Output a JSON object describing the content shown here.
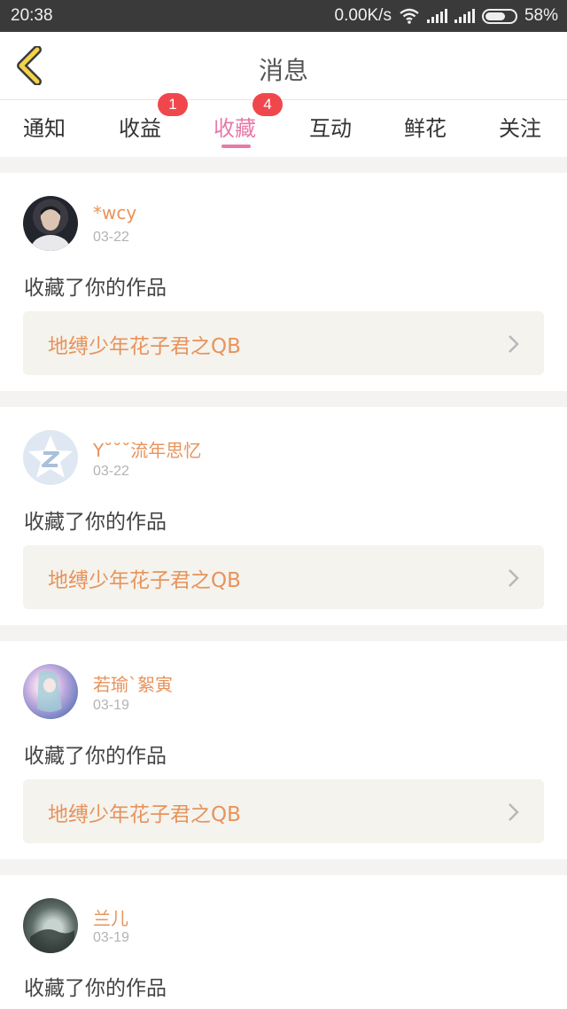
{
  "status_bar": {
    "time": "20:38",
    "network_speed": "0.00K/s",
    "battery": "58%",
    "battery_level": 0.58,
    "icons": [
      "wifi-icon",
      "signal-icon",
      "signal-icon",
      "battery-icon"
    ]
  },
  "header": {
    "title": "消息",
    "back_icon": "chevron-left-icon"
  },
  "tabs": [
    {
      "label": "通知",
      "badge": ""
    },
    {
      "label": "收益",
      "badge": "1"
    },
    {
      "label": "收藏",
      "badge": "4",
      "active": true
    },
    {
      "label": "互动",
      "badge": ""
    },
    {
      "label": "鲜花",
      "badge": ""
    },
    {
      "label": "关注",
      "badge": ""
    }
  ],
  "messages": [
    {
      "username": "*wcy",
      "date": "03-22",
      "text": "收藏了你的作品",
      "work_title": "地缚少年花子君之QB"
    },
    {
      "username": "Y˘˘˘流年思忆",
      "date": "03-22",
      "text": "收藏了你的作品",
      "work_title": "地缚少年花子君之QB"
    },
    {
      "username": "若瑜`絮寅",
      "date": "03-19",
      "text": "收藏了你的作品",
      "work_title": "地缚少年花子君之QB"
    },
    {
      "username": "兰儿",
      "date": "03-19",
      "text": "收藏了你的作品",
      "work_title": ""
    }
  ],
  "colors": {
    "accent_pink": "#e67aa8",
    "username_orange": "#e8935b",
    "badge_red": "#f0474d",
    "back_yellow": "#f2d34a"
  }
}
